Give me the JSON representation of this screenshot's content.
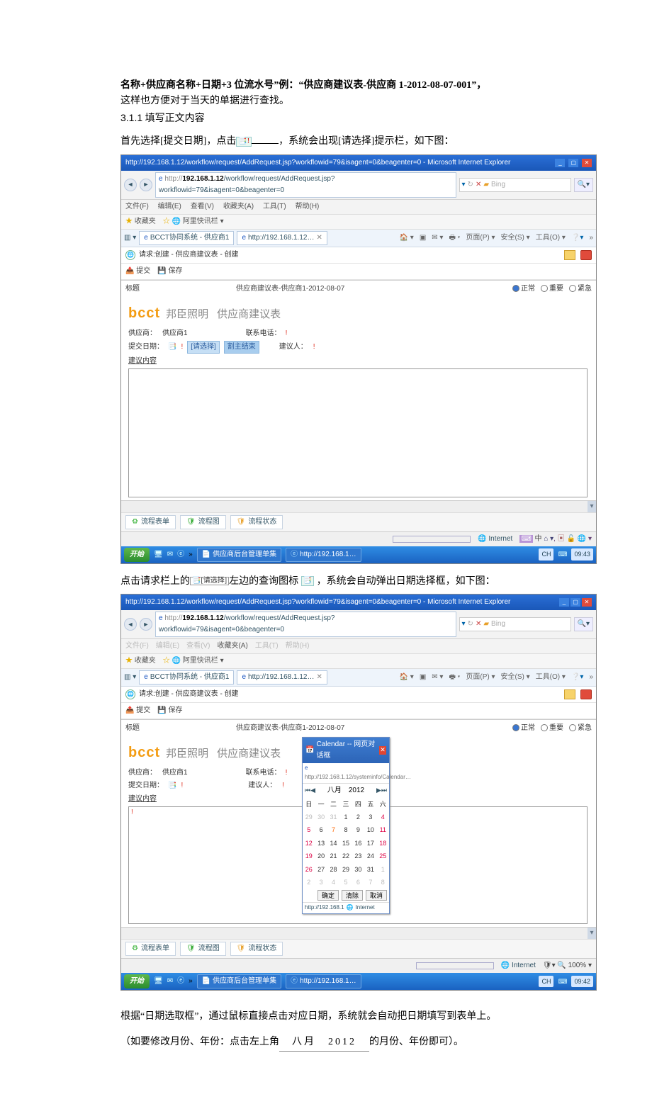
{
  "doc": {
    "heading_line": "名称+供应商名称+日期+3 位流水号”例：“供应商建议表-供应商 1-2012-08-07-001”，",
    "heading_sub": "这样也方便对于当天的单据进行查找。",
    "section_num": "3.1.1",
    "section_text": "填写正文内容",
    "p1_before": "首先选择[提交日期]，点击",
    "p1_after": "，系统会出现[请选择]提示栏，如下图：",
    "p2_before": "点击请求栏上的",
    "p2_mid": "左边的查询图标",
    "p2_after": "，系统会自动弹出日期选择框，如下图：",
    "reqsel_text": "[请选择]",
    "p3": "根据“日期选取框”，通过鼠标直接点击对应日期，系统就会自动把日期填写到表单上。",
    "p4_before": "（如要修改月份、年份：点击左上角",
    "month_year": "八月　2012",
    "p4_after": "的月份、年份即可）。"
  },
  "ie": {
    "title": "http://192.168.1.12/workflow/request/AddRequest.jsp?workflowid=79&isagent=0&beagenter=0 - Microsoft Internet Explorer",
    "url": "http://192.168.1.12/workflow/request/AddRequest.jsp?workflowid=79&isagent=0&beagenter=0",
    "search_engine": "Bing",
    "menu": {
      "file": "文件(F)",
      "edit": "编辑(E)",
      "view": "查看(V)",
      "fav": "收藏夹(A)",
      "tool": "工具(T)",
      "help": "帮助(H)"
    },
    "favbar": {
      "fav": "收藏夹",
      "site": "阿里快讯栏"
    },
    "tab1": "BCCT协同系统 - 供应商1",
    "tab2": "http://192.168.1.12…",
    "toolbar": {
      "home": "页面(P)",
      "safe": "安全(S)",
      "tool": "工具(O)"
    },
    "req_line": "请求:创建 - 供应商建议表 - 创建",
    "actions": {
      "submit": "提交",
      "save": "保存"
    },
    "titlerow": {
      "label": "标题",
      "value": "供应商建议表-供应商1-2012-08-07"
    },
    "urgency": {
      "normal": "正常",
      "important": "重要",
      "urgent": "紧急"
    },
    "form": {
      "logo_en": "bcct",
      "logo_cn": "邦臣照明",
      "title": "供应商建议表",
      "supplier_lbl": "供应商：",
      "supplier_val": "供应商1",
      "phone_lbl": "联系电话：",
      "date_lbl": "提交日期：",
      "reqsel": "[请选择]",
      "reqsel_btn": "割主结束",
      "proposer_lbl": "建议人：",
      "content_lbl": "建议内容"
    },
    "footer_tabs": {
      "form": "流程表单",
      "chart": "流程图",
      "status": "流程状态"
    },
    "status": {
      "inet": "Internet",
      "lang1": "CH",
      "zoom": "100%"
    },
    "taskbar": {
      "start": "开始",
      "app1": "供应商后台管理单集",
      "app2": "http://192.168.1…",
      "tray_lang": "中",
      "tray_ch": "CH",
      "tray_time": "09:43",
      "tray_time2": "09:42"
    }
  },
  "cal": {
    "title": "Calendar -- 网页对话框",
    "url": "http://192.168.1.12/systeminfo/Calendar…",
    "month": "八月",
    "year": "2012",
    "days": [
      "日",
      "一",
      "二",
      "三",
      "四",
      "五",
      "六"
    ],
    "rows": [
      [
        {
          "v": "29",
          "c": "oth"
        },
        {
          "v": "30",
          "c": "oth"
        },
        {
          "v": "31",
          "c": "oth"
        },
        {
          "v": "1"
        },
        {
          "v": "2"
        },
        {
          "v": "3"
        },
        {
          "v": "4",
          "c": "red"
        }
      ],
      [
        {
          "v": "5",
          "c": "red"
        },
        {
          "v": "6"
        },
        {
          "v": "7",
          "c": "today"
        },
        {
          "v": "8"
        },
        {
          "v": "9"
        },
        {
          "v": "10"
        },
        {
          "v": "11",
          "c": "red"
        }
      ],
      [
        {
          "v": "12",
          "c": "red"
        },
        {
          "v": "13"
        },
        {
          "v": "14"
        },
        {
          "v": "15"
        },
        {
          "v": "16"
        },
        {
          "v": "17"
        },
        {
          "v": "18",
          "c": "red"
        }
      ],
      [
        {
          "v": "19",
          "c": "red"
        },
        {
          "v": "20"
        },
        {
          "v": "21"
        },
        {
          "v": "22"
        },
        {
          "v": "23"
        },
        {
          "v": "24"
        },
        {
          "v": "25",
          "c": "red"
        }
      ],
      [
        {
          "v": "26",
          "c": "red"
        },
        {
          "v": "27"
        },
        {
          "v": "28"
        },
        {
          "v": "29"
        },
        {
          "v": "30"
        },
        {
          "v": "31"
        },
        {
          "v": "1",
          "c": "oth"
        }
      ],
      [
        {
          "v": "2",
          "c": "oth"
        },
        {
          "v": "3",
          "c": "oth"
        },
        {
          "v": "4",
          "c": "oth"
        },
        {
          "v": "5",
          "c": "oth"
        },
        {
          "v": "6",
          "c": "oth"
        },
        {
          "v": "7",
          "c": "oth"
        },
        {
          "v": "8",
          "c": "oth"
        }
      ]
    ],
    "btn_ok": "确定",
    "btn_clear": "清除",
    "btn_cancel": "取消",
    "status": "http://192.168.1",
    "status_inet": "Internet"
  }
}
